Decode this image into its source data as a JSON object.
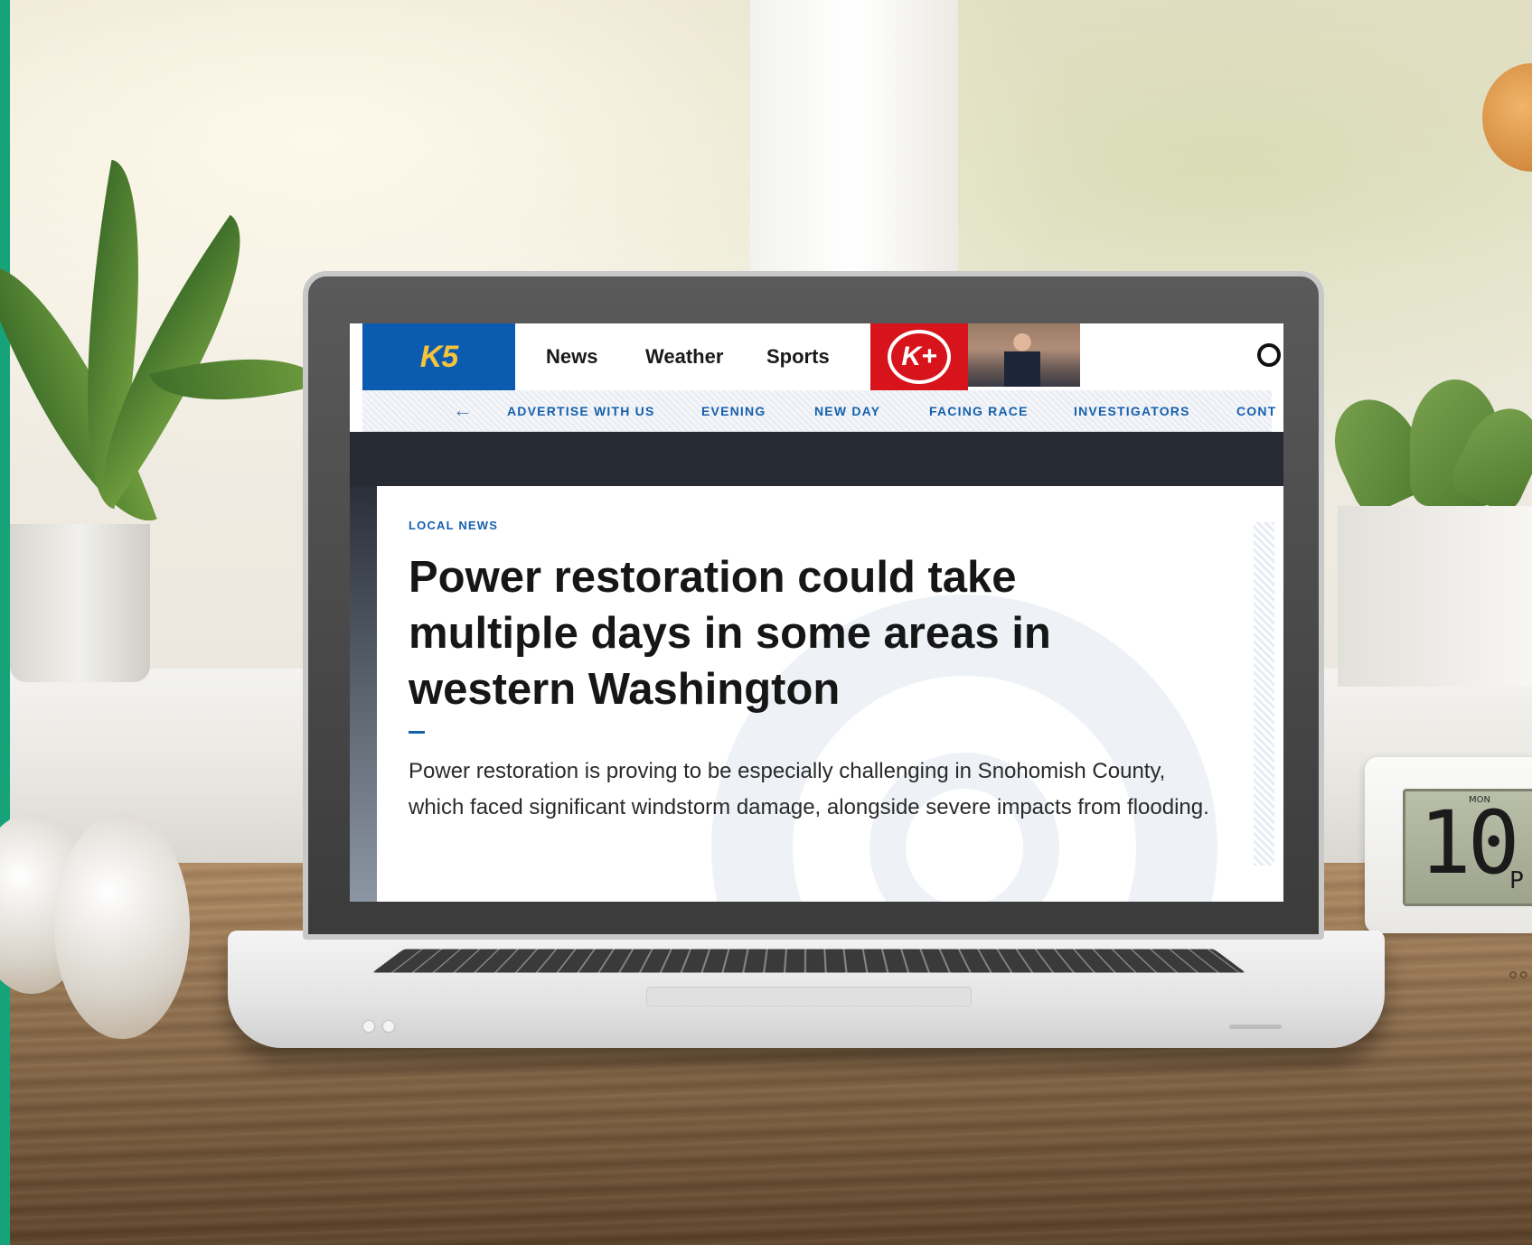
{
  "site": {
    "logo": "K5",
    "nav": [
      "News",
      "Weather",
      "Sports"
    ],
    "plus_logo": "K+"
  },
  "subnav": [
    "ADVERTISE WITH US",
    "EVENING",
    "NEW DAY",
    "FACING RACE",
    "INVESTIGATORS",
    "CONT"
  ],
  "article": {
    "category": "LOCAL NEWS",
    "headline": "Power restoration could take multiple days in some areas in western Washington",
    "summary": "Power restoration is proving to be especially challenging in Snohomish County, which faced significant windstorm damage, alongside severe impacts from flooding."
  },
  "clock": {
    "day": "MON",
    "digits": "10:",
    "ampm": "P"
  },
  "colors": {
    "brand_blue": "#0b5cb0",
    "brand_red": "#d7131b",
    "link_blue": "#1560ad",
    "accent_green": "#17a37a"
  }
}
